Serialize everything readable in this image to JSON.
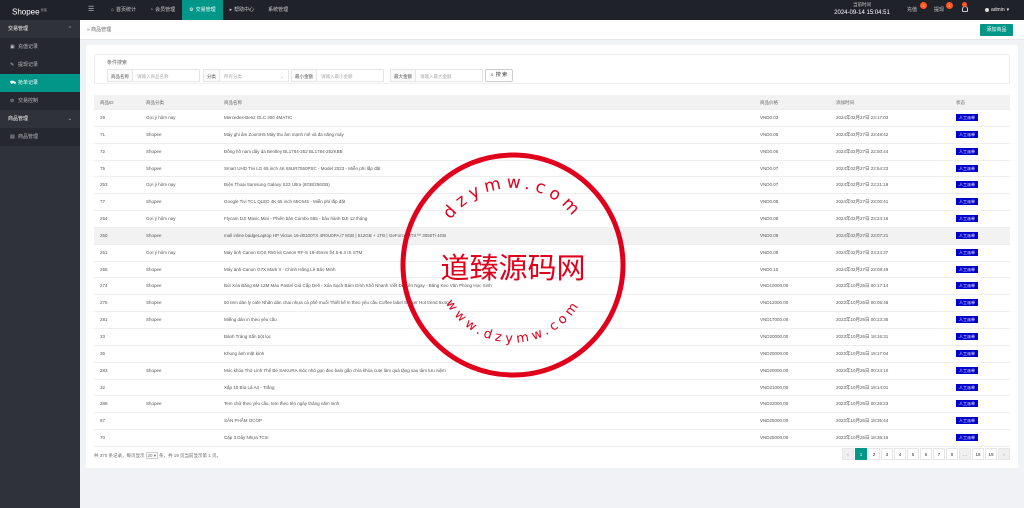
{
  "app": {
    "logo": "Shopee",
    "logo_sup": "管理"
  },
  "topnav": [
    {
      "label": "首页统计",
      "icon": "home-icon",
      "glyph": "⌂"
    },
    {
      "label": "会员管理",
      "icon": "user-icon",
      "glyph": "◔"
    },
    {
      "label": "交易管理",
      "icon": "settings-icon",
      "glyph": "⚙"
    },
    {
      "label": "帮助中心",
      "icon": "help-icon",
      "glyph": "▸"
    },
    {
      "label": "系统管理",
      "icon": "",
      "glyph": ""
    }
  ],
  "header": {
    "clock_label": "当前时间",
    "clock_value": "2024-09-14 15:04:51",
    "recharge_label": "充值",
    "recharge_badge": "1",
    "withdraw_label": "提现",
    "withdraw_badge": "1",
    "user_name": "admin"
  },
  "sidebar": {
    "groups": [
      {
        "label": "交易管理",
        "items": [
          {
            "label": "充值记录",
            "icon": "wallet-icon",
            "glyph": "▣",
            "active": false
          },
          {
            "label": "提现记录",
            "icon": "pen-icon",
            "glyph": "✎",
            "active": false
          },
          {
            "label": "抢单记录",
            "icon": "cart-icon",
            "glyph": "⛟",
            "active": true
          },
          {
            "label": "交易控制",
            "icon": "control-icon",
            "glyph": "⊘",
            "active": false
          }
        ]
      },
      {
        "label": "商品管理",
        "items": [
          {
            "label": "商品管理",
            "icon": "goods-icon",
            "glyph": "▤",
            "active": false
          }
        ]
      }
    ]
  },
  "breadcrumb": "商品管理",
  "add_button": "添加商品",
  "search": {
    "title": "条件搜索",
    "name_label": "商品名称",
    "name_placeholder": "请输入商品名称",
    "cat_label": "分类",
    "cat_value": "所有分类",
    "min_label": "最小金额",
    "min_placeholder": "请输入最小金额",
    "max_label": "最大金额",
    "max_placeholder": "请输入最大金额",
    "button": "搜 索"
  },
  "table": {
    "columns": [
      "商品ID",
      "商品分类",
      "商品名称",
      "商品价格",
      "添加时间",
      "状态"
    ],
    "rows": [
      [
        "29",
        "Gợi ý hôm nay",
        "Mercedes-Benz GLC 300 4MATIC",
        "VND0.03",
        "2024年02月27日 23:17:03",
        "人工派单"
      ],
      [
        "71",
        "Shopee",
        "Máy ghi âm ZoomH5 Máy thu âm mạnh mẽ và đa năng máy",
        "VND0.05",
        "2024年02月27日 22:48:42",
        "人工派单"
      ],
      [
        "72",
        "Shopee",
        "Đồng hồ nam dây da Bentley BL1784-252 BL1784-252KBB",
        "VND0.06",
        "2024年02月27日 22:50:44",
        "人工派单"
      ],
      [
        "75",
        "Shopee",
        "Smart UHD Tivi LG 65 inch 4K 65UR7550PSC - Model 2023 - Miễn phí lắp đặt",
        "VND0.07",
        "2024年02月27日 22:54:23",
        "人工派单"
      ],
      [
        "253",
        "Gợi ý hôm nay",
        "Điện Thoại Samsung Galaxy S23 Ultra (8GB/256GB)",
        "VND0.07",
        "2024年02月27日 23:21:19",
        "人工派单"
      ],
      [
        "77",
        "Shopee",
        "Google Tivi TCL QLED 4K 65 inch 65C645 - Miễn phí lắp đặt",
        "VND0.08",
        "2024年02月27日 23:00:41",
        "人工派单"
      ],
      [
        "254",
        "Gợi ý hôm nay",
        "Flycam DJI Mavic Mini - Phiên bản Combo 555 - bảo hành DJI 12 tháng",
        "VND0.08",
        "2024年02月27日 23:24:16",
        "人工派单"
      ],
      [
        "250",
        "Shopee",
        "mall inline badgeLaptop HP Victus 16-d0100TX 4R0U0PA i7 8GB | 512GB + 1TB | GeForce RTX™ 3050Ti 4GB",
        "VND0.09",
        "2024年02月27日 23:07:21",
        "人工派单"
      ],
      [
        "251",
        "Gợi ý hôm nay",
        "Máy ảnh Canon EOS R50 kit Canon RF-S 18-45mm f/4.5-6.3 IS STM",
        "VND0.09",
        "2024年02月27日 23:24:37",
        "人工派单"
      ],
      [
        "255",
        "Shopee",
        "Máy ảnh Canon G7X Mark II - Chính Hãng Lê Bảo Minh",
        "VND0.10",
        "2024年02月27日 23:08:49",
        "人工派单"
      ],
      [
        "274",
        "Shopee",
        "Bút Xóa Băng 6M 12M Màu Pastel Giá Cấp Deli - Xóa Sạch Bám Dính Khô Nhanh Viết Đè Lên Ngay - Băng Keo Văn Phòng Học Sinh",
        "VND10000.00",
        "2023年10月26日 00:17:14",
        "人工派单"
      ],
      [
        "276",
        "Shopee",
        "50 tem dán ly cafe Nhãn dán chai nhựa cà phê muối Thiết kế in theo yêu cầu Coffee label Sticker Hot trend 6x4cm",
        "VND12000.00",
        "2023年10月26日 00:05:48",
        "人工派单"
      ],
      [
        "281",
        "Shopee",
        "Miếng dán in theo yêu cầu",
        "VND17000.00",
        "2023年10月26日 00:23:35",
        "人工派单"
      ],
      [
        "33",
        "",
        "Bánh Tráng Sắn bột lọc",
        "VND20000.00",
        "2023年10月26日 18:16:31",
        "人工派单"
      ],
      [
        "36",
        "",
        "Khung ảnh mặt kính",
        "VND20000.00",
        "2023年10月26日 18:17:04",
        "人工派单"
      ],
      [
        "283",
        "Shopee",
        "Móc khóa Thỏ Linh Thể Bé SAKURA móc nhỏ gọn đeo balo gắn chìa khóa cute làm quà tặng sau tâm lưu niệm",
        "VND20000.00",
        "2023年10月26日 00:24:10",
        "人工派单"
      ],
      [
        "32",
        "",
        "Xấp 10 Bìa Lá A4 - Trắng",
        "VND21000.00",
        "2023年10月26日 18:14:01",
        "人工派单"
      ],
      [
        "286",
        "Shopee",
        "Tem chữ theo yêu cầu, tem theo tên ngày tháng năm sinh",
        "VND22000.00",
        "2023年10月26日 00:26:23",
        "人工派单"
      ],
      [
        "67",
        "",
        "SẢN PHẨM OCOP",
        "VND25000.00",
        "2023年10月26日 18:35:44",
        "人工派单"
      ],
      [
        "70",
        "",
        "Cặp 3 Dây Nhựa 7Cm",
        "VND25000.00",
        "2023年10月26日 18:36:16",
        "人工派单"
      ]
    ]
  },
  "pagination": {
    "info_prefix": "共 370 条记录，每页显示",
    "page_size": "20",
    "info_suffix": "条，共 19 页当前显示第 1 页。",
    "pages": [
      "‹",
      "1",
      "2",
      "3",
      "4",
      "5",
      "6",
      "7",
      "8",
      "…",
      "18",
      "19",
      "›"
    ],
    "current": "1"
  },
  "watermark": {
    "top": "dzymw.com",
    "center": "道臻源码网",
    "bottom": "www.dzymw.com",
    "color": "#e0001b"
  }
}
